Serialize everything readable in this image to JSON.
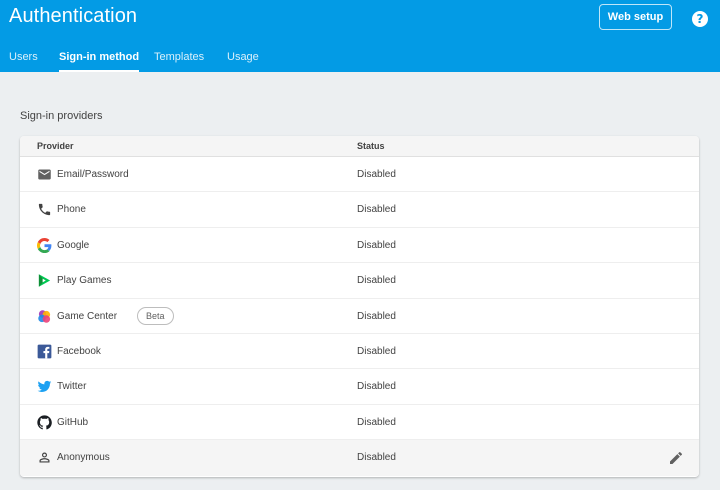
{
  "header": {
    "title": "Authentication",
    "web_setup_label": "Web setup",
    "help_glyph": "?"
  },
  "tabs": [
    {
      "label": "Users",
      "active": false
    },
    {
      "label": "Sign-in method",
      "active": true
    },
    {
      "label": "Templates",
      "active": false
    },
    {
      "label": "Usage",
      "active": false
    }
  ],
  "section": {
    "label": "Sign-in providers"
  },
  "table": {
    "columns": [
      "Provider",
      "Status"
    ],
    "rows": [
      {
        "provider": "Email/Password",
        "status": "Disabled",
        "icon": "email-icon"
      },
      {
        "provider": "Phone",
        "status": "Disabled",
        "icon": "phone-icon"
      },
      {
        "provider": "Google",
        "status": "Disabled",
        "icon": "google-icon"
      },
      {
        "provider": "Play Games",
        "status": "Disabled",
        "icon": "play-games-icon"
      },
      {
        "provider": "Game Center",
        "status": "Disabled",
        "icon": "game-center-icon",
        "badge": "Beta"
      },
      {
        "provider": "Facebook",
        "status": "Disabled",
        "icon": "facebook-icon"
      },
      {
        "provider": "Twitter",
        "status": "Disabled",
        "icon": "twitter-icon"
      },
      {
        "provider": "GitHub",
        "status": "Disabled",
        "icon": "github-icon"
      },
      {
        "provider": "Anonymous",
        "status": "Disabled",
        "icon": "person-icon"
      }
    ]
  },
  "colors": {
    "header_bg": "#039be5",
    "page_bg": "#eceff1"
  }
}
